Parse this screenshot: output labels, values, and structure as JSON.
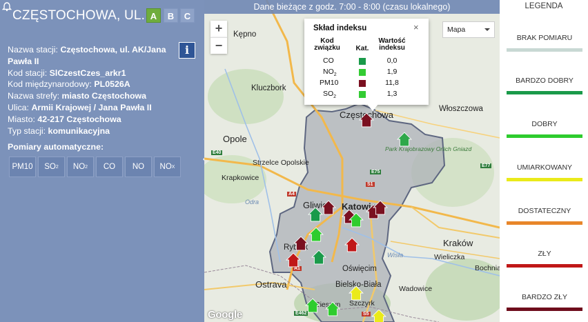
{
  "header": {
    "station_title": "CZĘSTOCHOWA, UL. ...",
    "tabs": [
      "A",
      "B",
      "C"
    ],
    "info_label": "i"
  },
  "details": {
    "station_name_label": "Nazwa stacji:",
    "station_name_value": "Częstochowa, ul. AK/Jana Pawła II",
    "station_code_label": "Kod stacji:",
    "station_code_value": "SlCzestCzes_arkr1",
    "intl_code_label": "Kod międzynarodowy:",
    "intl_code_value": "PL0526A",
    "zone_label": "Nazwa strefy:",
    "zone_value": "miasto Częstochowa",
    "street_label": "Ulica:",
    "street_value": "Armii Krajowej / Jana Pawła II",
    "city_label": "Miasto:",
    "city_value": "42-217 Częstochowa",
    "type_label": "Typ stacji:",
    "type_value": "komunikacyjna"
  },
  "measurements": {
    "title": "Pomiary automatyczne:",
    "buttons": [
      {
        "base": "PM10",
        "sub": ""
      },
      {
        "base": "SO",
        "sub": "2"
      },
      {
        "base": "NO",
        "sub": "2"
      },
      {
        "base": "CO",
        "sub": ""
      },
      {
        "base": "NO",
        "sub": ""
      },
      {
        "base": "NO",
        "sub": "X"
      }
    ]
  },
  "map": {
    "header": "Dane bieżące z godz. 7:00 - 8:00 (czasu lokalnego)",
    "zoom_in": "+",
    "zoom_out": "−",
    "map_type": "Mapa",
    "google_logo": "Google",
    "cities": [
      "Kępno",
      "Kluczbork",
      "Opole",
      "Strzelce Opolskie",
      "Krapkowice",
      "Włoszczowa",
      "Częstochowa",
      "Gliwice",
      "Katowice",
      "Rybnik",
      "Oświęcim",
      "Kraków",
      "Wieliczka",
      "Bochnia",
      "Ostrava",
      "Bielsko-Biała",
      "Wadowice",
      "Szczyrk",
      "Cieszyn",
      "Odra",
      "Wisła"
    ],
    "park_label": "Park Krajobrazowy Orlich Gniazd",
    "roads": [
      "E40",
      "A4",
      "A1",
      "S1",
      "E75",
      "E77",
      "S5",
      "E462"
    ]
  },
  "popup": {
    "title": "Skład indeksu",
    "close": "×",
    "col_code": "Kod związku",
    "col_cat": "Kat.",
    "col_value": "Wartość indeksu",
    "rows": [
      {
        "base": "CO",
        "sub": "",
        "value": "0,0",
        "color": "#1a9a4a"
      },
      {
        "base": "NO",
        "sub": "2",
        "value": "1,9",
        "color": "#33cc33"
      },
      {
        "base": "PM10",
        "sub": "",
        "value": "11,8",
        "color": "#7a1020"
      },
      {
        "base": "SO",
        "sub": "2",
        "value": "1,3",
        "color": "#33cc33"
      }
    ]
  },
  "legend": {
    "title": "LEGENDA",
    "items": [
      {
        "label": "BRAK POMIARU",
        "color": "#c8d8d4"
      },
      {
        "label": "BARDZO DOBRY",
        "color": "#1a9a4a"
      },
      {
        "label": "DOBRY",
        "color": "#2ecc2e"
      },
      {
        "label": "UMIARKOWANY",
        "color": "#eaea1a"
      },
      {
        "label": "DOSTATECZNY",
        "color": "#e8862a"
      },
      {
        "label": "ZŁY",
        "color": "#c01818"
      },
      {
        "label": "BARDZO ZŁY",
        "color": "#6e0c1c"
      }
    ]
  }
}
